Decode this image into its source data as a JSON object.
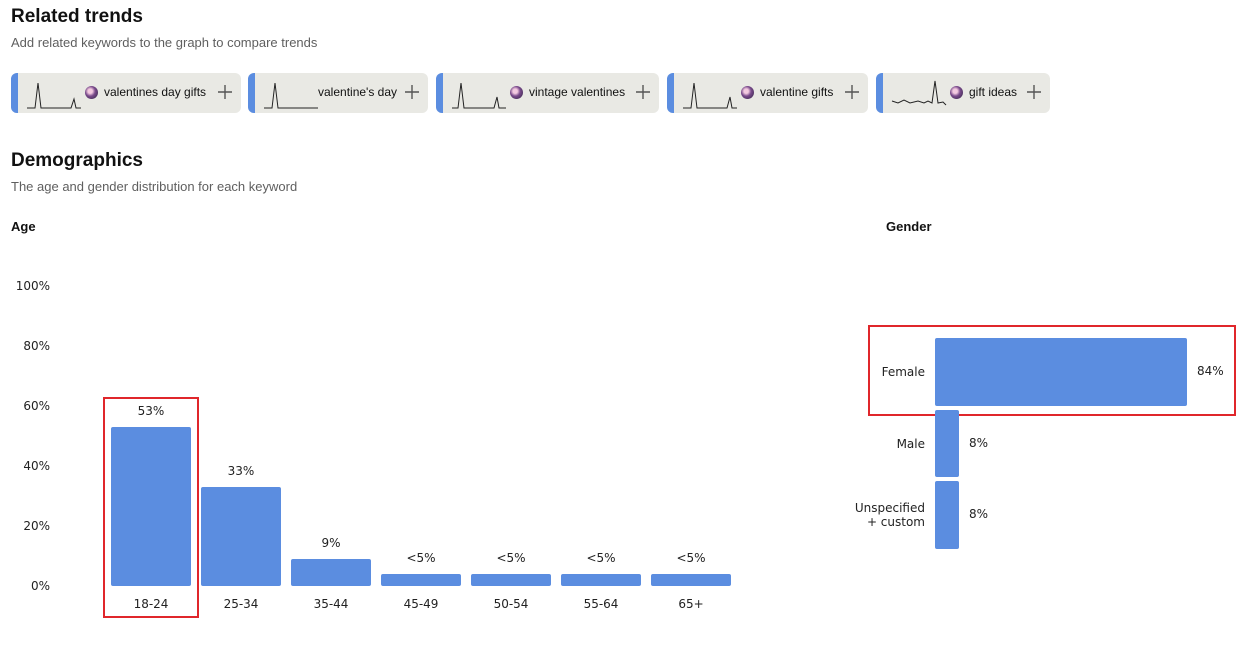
{
  "related_trends": {
    "title": "Related trends",
    "subtitle": "Add related keywords to the graph to compare trends",
    "pills": [
      {
        "label": "valentines day gifts",
        "has_avatar": true
      },
      {
        "label": "valentine's day",
        "has_avatar": false
      },
      {
        "label": "vintage valentines",
        "has_avatar": true
      },
      {
        "label": "valentine gifts",
        "has_avatar": true
      },
      {
        "label": "gift ideas",
        "has_avatar": true
      }
    ],
    "add_icon": "plus-icon"
  },
  "demographics": {
    "title": "Demographics",
    "subtitle": "The age and gender distribution for each keyword",
    "age_label": "Age",
    "gender_label": "Gender"
  },
  "colors": {
    "bar": "#5b8de0",
    "highlight": "#e0262b",
    "pill_bg": "#e9e9e4"
  },
  "chart_data": [
    {
      "type": "bar",
      "title": "Age",
      "categories": [
        "18-24",
        "25-34",
        "35-44",
        "45-49",
        "50-54",
        "55-64",
        "65+"
      ],
      "values": [
        53,
        33,
        9,
        4,
        4,
        4,
        4
      ],
      "data_labels": [
        "53%",
        "33%",
        "9%",
        "<5%",
        "<5%",
        "<5%",
        "<5%"
      ],
      "yticks": [
        "100%",
        "80%",
        "60%",
        "40%",
        "20%",
        "0%"
      ],
      "ylim": [
        0,
        100
      ],
      "highlighted_category": "18-24"
    },
    {
      "type": "bar",
      "orientation": "horizontal",
      "title": "Gender",
      "categories": [
        "Female",
        "Male",
        "Unspecified\n+ custom"
      ],
      "values": [
        84,
        8,
        8
      ],
      "data_labels": [
        "84%",
        "8%",
        "8%"
      ],
      "highlighted_category": "Female"
    }
  ]
}
